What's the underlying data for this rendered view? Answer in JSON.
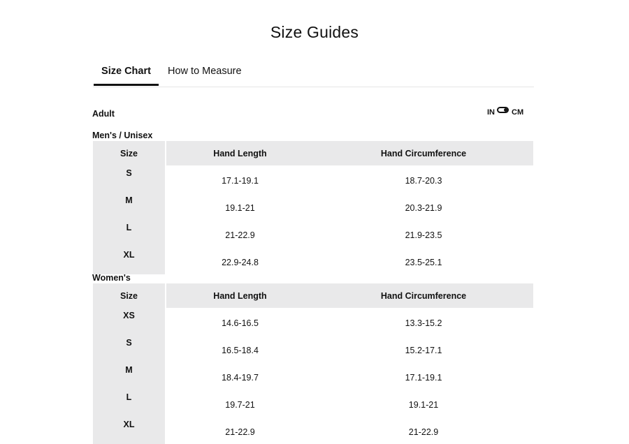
{
  "page": {
    "title": "Size Guides"
  },
  "tabs": [
    {
      "label": "Size Chart",
      "active": true
    },
    {
      "label": "How to Measure",
      "active": false
    }
  ],
  "category": "Adult",
  "unit_toggle": {
    "left": "IN",
    "right": "CM",
    "selected": "CM"
  },
  "columns": {
    "size": "Size",
    "hand_length": "Hand Length",
    "hand_circumference": "Hand Circumference"
  },
  "mens": {
    "label": "Men's / Unisex",
    "rows": [
      {
        "size": "S",
        "length": "17.1-19.1",
        "circ": "18.7-20.3"
      },
      {
        "size": "M",
        "length": "19.1-21",
        "circ": "20.3-21.9"
      },
      {
        "size": "L",
        "length": "21-22.9",
        "circ": "21.9-23.5"
      },
      {
        "size": "XL",
        "length": "22.9-24.8",
        "circ": "23.5-25.1"
      }
    ]
  },
  "womens": {
    "label": "Women's",
    "rows": [
      {
        "size": "XS",
        "length": "14.6-16.5",
        "circ": "13.3-15.2"
      },
      {
        "size": "S",
        "length": "16.5-18.4",
        "circ": "15.2-17.1"
      },
      {
        "size": "M",
        "length": "18.4-19.7",
        "circ": "17.1-19.1"
      },
      {
        "size": "L",
        "length": "19.7-21",
        "circ": "19.1-21"
      },
      {
        "size": "XL",
        "length": "21-22.9",
        "circ": "21-22.9"
      }
    ]
  }
}
